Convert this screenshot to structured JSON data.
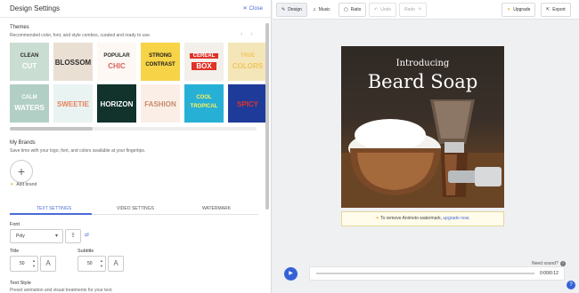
{
  "panel": {
    "title": "Design Settings",
    "close_label": "Close",
    "themes_title": "Themes",
    "themes_subtitle": "Recommended color, font, and style combos, curated and ready to use.",
    "themes": [
      {
        "lines": [
          "CLEAN",
          "CUT"
        ],
        "bg": "#c9ddd2",
        "fg": "#ffffff",
        "accent": "#2d2d2d"
      },
      {
        "lines": [
          "BLOSSOM"
        ],
        "bg": "#eadfd3",
        "fg": "#2d2d2d",
        "accent": "#2d2d2d"
      },
      {
        "lines": [
          "POPULAR",
          "CHIC"
        ],
        "bg": "#fdf8f3",
        "fg": "#d9645c",
        "accent": "#2d2d2d"
      },
      {
        "lines": [
          "STRONG",
          "CONTRAST"
        ],
        "bg": "#f7d447",
        "fg": "#1b1b1b",
        "accent": "#1b1b1b"
      },
      {
        "lines": [
          "CEREAL",
          "BOX"
        ],
        "bg": "#f3f0ec",
        "fg": "#ffffff",
        "accent": "#e03226"
      },
      {
        "lines": [
          "TRUE",
          "COLORS"
        ],
        "bg": "#f4e6b8",
        "fg": "#f2c55c",
        "accent": "#f2c55c"
      },
      {
        "lines": [
          "CALM",
          "WATERS"
        ],
        "bg": "#b2cfc5",
        "fg": "#ffffff",
        "accent": "#ffffff"
      },
      {
        "lines": [
          "SWEETIE"
        ],
        "bg": "#e9f3f1",
        "fg": "#e8815d",
        "accent": "#e8815d"
      },
      {
        "lines": [
          "HORIZON"
        ],
        "bg": "#11332c",
        "fg": "#ffffff",
        "accent": "#ffffff"
      },
      {
        "lines": [
          "FASHION"
        ],
        "bg": "#fbeee6",
        "fg": "#c78a6e",
        "accent": "#c78a6e"
      },
      {
        "lines": [
          "COOL",
          "TROPICAL"
        ],
        "bg": "#27b0d6",
        "fg": "#fff15a",
        "accent": "#fff15a"
      },
      {
        "lines": [
          "SPICY"
        ],
        "bg": "#1f3b9a",
        "fg": "#ffffff",
        "accent": "#e0342a"
      }
    ],
    "brands_title": "My Brands",
    "brands_subtitle": "Save time with your logo, font, and colors available at your fingertips.",
    "add_brand_label": "Add brand",
    "tabs": [
      "TEXT SETTINGS",
      "VIDEO SETTINGS",
      "WATERMARK"
    ],
    "font_label": "Font",
    "font_value": "Poly",
    "title_label": "Title",
    "title_size": "50",
    "subtitle_label": "Subtitle",
    "subtitle_size": "50",
    "text_style_label": "Text Style",
    "text_style_subtitle": "Preset animation and visual treatments for your text."
  },
  "toolbar": {
    "design": "Design",
    "music": "Music",
    "ratio": "Ratio",
    "undo": "Undo",
    "redo": "Redo",
    "upgrade": "Upgrade",
    "export": "Export"
  },
  "canvas": {
    "line1": "Introducing",
    "line2": "Beard Soap"
  },
  "watermark": {
    "text": "To remove Animoto watermark,",
    "link": "upgrade now."
  },
  "player": {
    "need_sound": "Need sound?",
    "time": "0:00/0:12"
  },
  "colors": {
    "accent": "#4a6bd6",
    "play": "#3662d6"
  }
}
